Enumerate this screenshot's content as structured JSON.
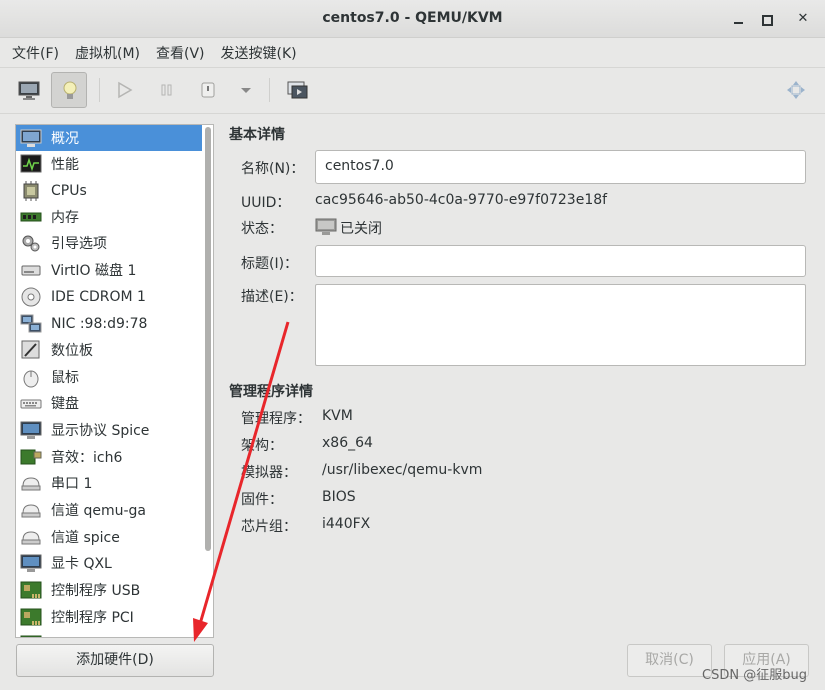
{
  "window": {
    "title": "centos7.0 - QEMU/KVM"
  },
  "menu": [
    "文件(F)",
    "虚拟机(M)",
    "查看(V)",
    "发送按键(K)"
  ],
  "sidebar": {
    "items": [
      {
        "label": "概况",
        "icon": "overview-icon",
        "selected": true
      },
      {
        "label": "性能",
        "icon": "performance-icon"
      },
      {
        "label": "CPUs",
        "icon": "cpu-icon"
      },
      {
        "label": "内存",
        "icon": "memory-icon"
      },
      {
        "label": "引导选项",
        "icon": "boot-options-icon"
      },
      {
        "label": "VirtIO 磁盘 1",
        "icon": "disk-icon"
      },
      {
        "label": "IDE CDROM 1",
        "icon": "cdrom-icon"
      },
      {
        "label": "NIC :98:d9:78",
        "icon": "nic-icon"
      },
      {
        "label": "数位板",
        "icon": "tablet-icon"
      },
      {
        "label": "鼠标",
        "icon": "mouse-icon"
      },
      {
        "label": "键盘",
        "icon": "keyboard-icon"
      },
      {
        "label": "显示协议 Spice",
        "icon": "display-icon"
      },
      {
        "label": "音效：ich6",
        "icon": "sound-icon"
      },
      {
        "label": "串口 1",
        "icon": "serial-icon"
      },
      {
        "label": "信道 qemu-ga",
        "icon": "channel-icon"
      },
      {
        "label": "信道 spice",
        "icon": "channel-icon"
      },
      {
        "label": "显卡 QXL",
        "icon": "video-icon"
      },
      {
        "label": "控制程序 USB",
        "icon": "controller-icon"
      },
      {
        "label": "控制程序 PCI",
        "icon": "controller-icon"
      }
    ],
    "add_hardware_label": "添加硬件(D)"
  },
  "basic": {
    "section_title": "基本详情",
    "name_label": "名称(N)：",
    "name_value": "centos7.0",
    "uuid_label": "UUID：",
    "uuid_value": "cac95646-ab50-4c0a-9770-e97f0723e18f",
    "status_label": "状态：",
    "status_value": "已关闭",
    "title_label": "标题(I)：",
    "title_value": "",
    "desc_label": "描述(E)："
  },
  "hypervisor": {
    "section_title": "管理程序详情",
    "rows": [
      {
        "label": "管理程序：",
        "value": "KVM"
      },
      {
        "label": "架构：",
        "value": "x86_64"
      },
      {
        "label": "模拟器：",
        "value": "/usr/libexec/qemu-kvm"
      },
      {
        "label": "固件：",
        "value": "BIOS"
      },
      {
        "label": "芯片组：",
        "value": "i440FX"
      }
    ]
  },
  "buttons": {
    "cancel": "取消(C)",
    "apply": "应用(A)"
  },
  "watermark": "CSDN @征服bug",
  "colors": {
    "selection": "#4a90d9",
    "annotation_arrow": "#e8262b"
  }
}
